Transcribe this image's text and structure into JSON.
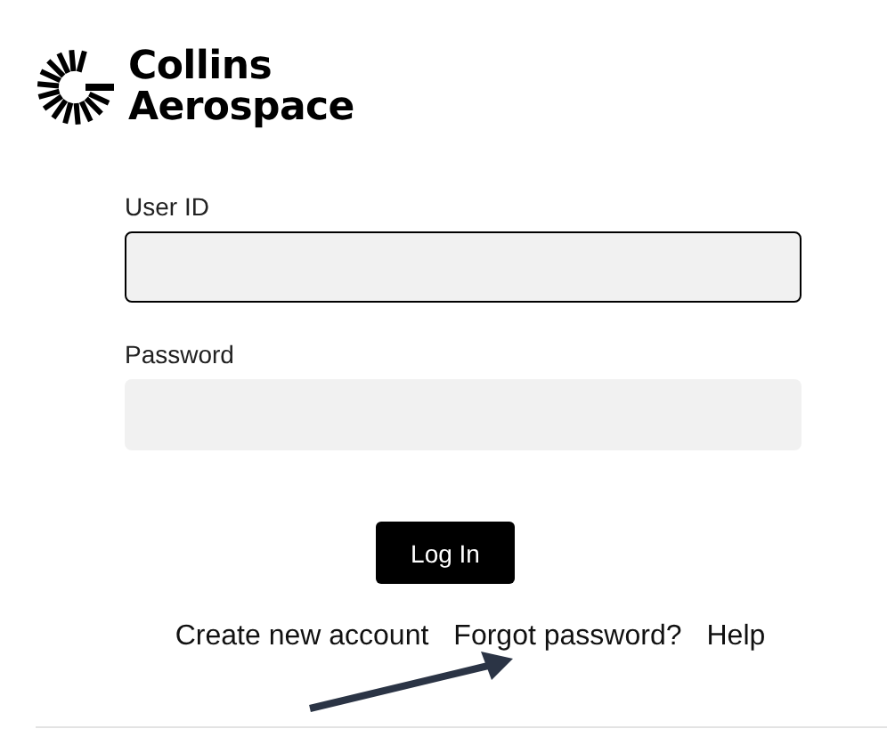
{
  "logo": {
    "line_1": "Collins",
    "line_2": "Aerospace"
  },
  "fields": [
    {
      "label": "User ID",
      "focused": true
    },
    {
      "label": "Password",
      "focused": false
    }
  ],
  "login_button": "Log In",
  "links": [
    "Create new account",
    "Forgot password?",
    "Help"
  ]
}
